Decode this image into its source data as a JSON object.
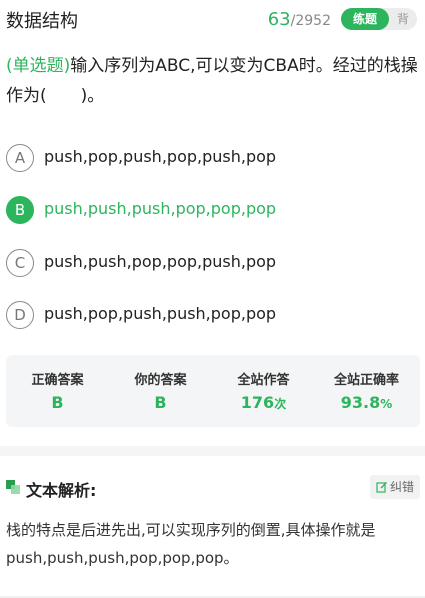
{
  "header": {
    "title": "数据结构",
    "progress_current": "63",
    "progress_total": "/2952",
    "mode_active": "练题",
    "mode_inactive": "背"
  },
  "question": {
    "type_label": "(单选题)",
    "text": "输入序列为ABC,可以变为CBA时。经过的栈操作为(　　)。"
  },
  "options": [
    {
      "letter": "A",
      "text": "push,pop,push,pop,push,pop"
    },
    {
      "letter": "B",
      "text": "push,push,push,pop,pop,pop"
    },
    {
      "letter": "C",
      "text": "push,push,pop,pop,push,pop"
    },
    {
      "letter": "D",
      "text": "push,pop,push,push,pop,pop"
    }
  ],
  "correct_option": "B",
  "stats": {
    "correct_answer_label": "正确答案",
    "correct_answer": "B",
    "your_answer_label": "你的答案",
    "your_answer": "B",
    "site_attempts_label": "全站作答",
    "site_attempts": "176",
    "site_attempts_unit": "次",
    "site_accuracy_label": "全站正确率",
    "site_accuracy": "93.8",
    "site_accuracy_unit": "%"
  },
  "analysis": {
    "title": "文本解析:",
    "report_label": "纠错",
    "body": "栈的特点是后进先出,可以实现序列的倒置,具体操作就是push,push,push,pop,pop,pop。"
  },
  "colors": {
    "accent": "#2db55d",
    "stats_bg": "#f4f5f6"
  }
}
